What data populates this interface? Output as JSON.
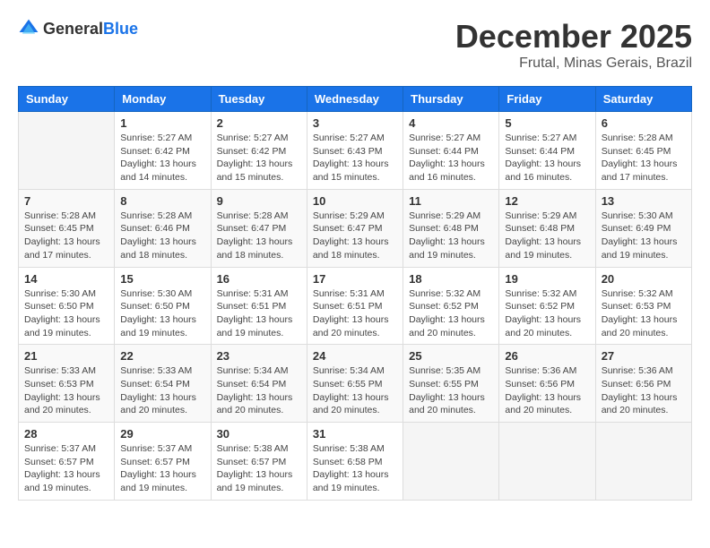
{
  "logo": {
    "text_general": "General",
    "text_blue": "Blue"
  },
  "header": {
    "month": "December 2025",
    "location": "Frutal, Minas Gerais, Brazil"
  },
  "weekdays": [
    "Sunday",
    "Monday",
    "Tuesday",
    "Wednesday",
    "Thursday",
    "Friday",
    "Saturday"
  ],
  "weeks": [
    [
      {
        "day": "",
        "info": ""
      },
      {
        "day": "1",
        "info": "Sunrise: 5:27 AM\nSunset: 6:42 PM\nDaylight: 13 hours\nand 14 minutes."
      },
      {
        "day": "2",
        "info": "Sunrise: 5:27 AM\nSunset: 6:42 PM\nDaylight: 13 hours\nand 15 minutes."
      },
      {
        "day": "3",
        "info": "Sunrise: 5:27 AM\nSunset: 6:43 PM\nDaylight: 13 hours\nand 15 minutes."
      },
      {
        "day": "4",
        "info": "Sunrise: 5:27 AM\nSunset: 6:44 PM\nDaylight: 13 hours\nand 16 minutes."
      },
      {
        "day": "5",
        "info": "Sunrise: 5:27 AM\nSunset: 6:44 PM\nDaylight: 13 hours\nand 16 minutes."
      },
      {
        "day": "6",
        "info": "Sunrise: 5:28 AM\nSunset: 6:45 PM\nDaylight: 13 hours\nand 17 minutes."
      }
    ],
    [
      {
        "day": "7",
        "info": "Sunrise: 5:28 AM\nSunset: 6:45 PM\nDaylight: 13 hours\nand 17 minutes."
      },
      {
        "day": "8",
        "info": "Sunrise: 5:28 AM\nSunset: 6:46 PM\nDaylight: 13 hours\nand 18 minutes."
      },
      {
        "day": "9",
        "info": "Sunrise: 5:28 AM\nSunset: 6:47 PM\nDaylight: 13 hours\nand 18 minutes."
      },
      {
        "day": "10",
        "info": "Sunrise: 5:29 AM\nSunset: 6:47 PM\nDaylight: 13 hours\nand 18 minutes."
      },
      {
        "day": "11",
        "info": "Sunrise: 5:29 AM\nSunset: 6:48 PM\nDaylight: 13 hours\nand 19 minutes."
      },
      {
        "day": "12",
        "info": "Sunrise: 5:29 AM\nSunset: 6:48 PM\nDaylight: 13 hours\nand 19 minutes."
      },
      {
        "day": "13",
        "info": "Sunrise: 5:30 AM\nSunset: 6:49 PM\nDaylight: 13 hours\nand 19 minutes."
      }
    ],
    [
      {
        "day": "14",
        "info": "Sunrise: 5:30 AM\nSunset: 6:50 PM\nDaylight: 13 hours\nand 19 minutes."
      },
      {
        "day": "15",
        "info": "Sunrise: 5:30 AM\nSunset: 6:50 PM\nDaylight: 13 hours\nand 19 minutes."
      },
      {
        "day": "16",
        "info": "Sunrise: 5:31 AM\nSunset: 6:51 PM\nDaylight: 13 hours\nand 19 minutes."
      },
      {
        "day": "17",
        "info": "Sunrise: 5:31 AM\nSunset: 6:51 PM\nDaylight: 13 hours\nand 20 minutes."
      },
      {
        "day": "18",
        "info": "Sunrise: 5:32 AM\nSunset: 6:52 PM\nDaylight: 13 hours\nand 20 minutes."
      },
      {
        "day": "19",
        "info": "Sunrise: 5:32 AM\nSunset: 6:52 PM\nDaylight: 13 hours\nand 20 minutes."
      },
      {
        "day": "20",
        "info": "Sunrise: 5:32 AM\nSunset: 6:53 PM\nDaylight: 13 hours\nand 20 minutes."
      }
    ],
    [
      {
        "day": "21",
        "info": "Sunrise: 5:33 AM\nSunset: 6:53 PM\nDaylight: 13 hours\nand 20 minutes."
      },
      {
        "day": "22",
        "info": "Sunrise: 5:33 AM\nSunset: 6:54 PM\nDaylight: 13 hours\nand 20 minutes."
      },
      {
        "day": "23",
        "info": "Sunrise: 5:34 AM\nSunset: 6:54 PM\nDaylight: 13 hours\nand 20 minutes."
      },
      {
        "day": "24",
        "info": "Sunrise: 5:34 AM\nSunset: 6:55 PM\nDaylight: 13 hours\nand 20 minutes."
      },
      {
        "day": "25",
        "info": "Sunrise: 5:35 AM\nSunset: 6:55 PM\nDaylight: 13 hours\nand 20 minutes."
      },
      {
        "day": "26",
        "info": "Sunrise: 5:36 AM\nSunset: 6:56 PM\nDaylight: 13 hours\nand 20 minutes."
      },
      {
        "day": "27",
        "info": "Sunrise: 5:36 AM\nSunset: 6:56 PM\nDaylight: 13 hours\nand 20 minutes."
      }
    ],
    [
      {
        "day": "28",
        "info": "Sunrise: 5:37 AM\nSunset: 6:57 PM\nDaylight: 13 hours\nand 19 minutes."
      },
      {
        "day": "29",
        "info": "Sunrise: 5:37 AM\nSunset: 6:57 PM\nDaylight: 13 hours\nand 19 minutes."
      },
      {
        "day": "30",
        "info": "Sunrise: 5:38 AM\nSunset: 6:57 PM\nDaylight: 13 hours\nand 19 minutes."
      },
      {
        "day": "31",
        "info": "Sunrise: 5:38 AM\nSunset: 6:58 PM\nDaylight: 13 hours\nand 19 minutes."
      },
      {
        "day": "",
        "info": ""
      },
      {
        "day": "",
        "info": ""
      },
      {
        "day": "",
        "info": ""
      }
    ]
  ]
}
